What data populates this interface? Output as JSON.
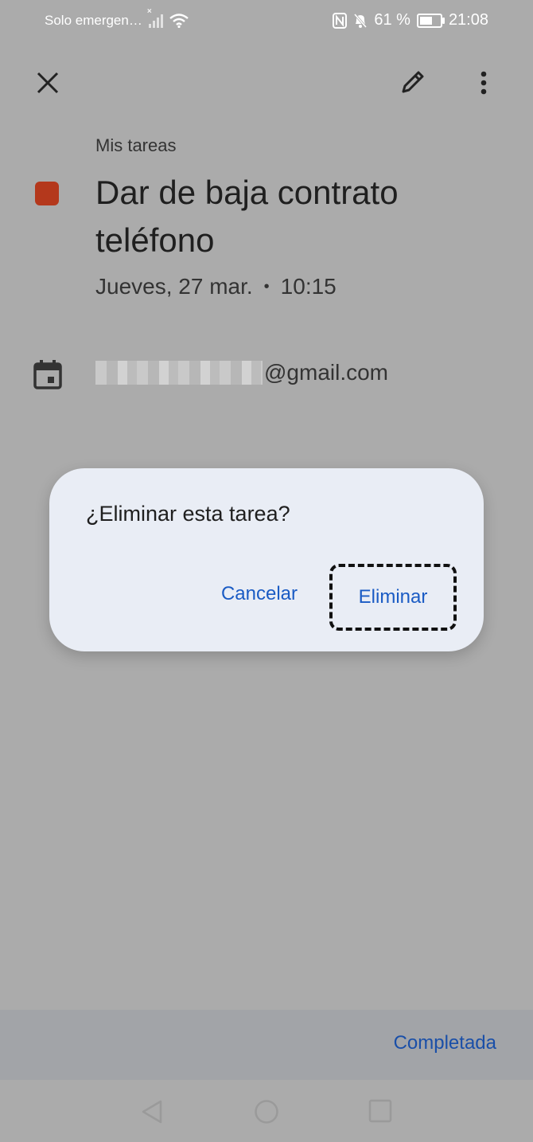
{
  "status_bar": {
    "carrier": "Solo emergen…",
    "battery_percent": "61 %",
    "battery_level": 0.61,
    "time": "21:08"
  },
  "toolbar": {
    "close_icon": "close-icon",
    "edit_icon": "pencil-icon",
    "more_icon": "more-vert-icon"
  },
  "task": {
    "list_name": "Mis tareas",
    "color": "#b4381c",
    "title": "Dar de baja contrato teléfono",
    "date": "Jueves, 27 mar.",
    "separator": "•",
    "time": "10:15",
    "account_suffix": "@gmail.com"
  },
  "dialog": {
    "message": "¿Eliminar esta tarea?",
    "cancel_label": "Cancelar",
    "delete_label": "Eliminar"
  },
  "bottom_bar": {
    "complete_label": "Completada"
  },
  "colors": {
    "accent": "#1a5bc4",
    "scrim_background": "#ababab",
    "dialog_background": "#e9edf5"
  }
}
